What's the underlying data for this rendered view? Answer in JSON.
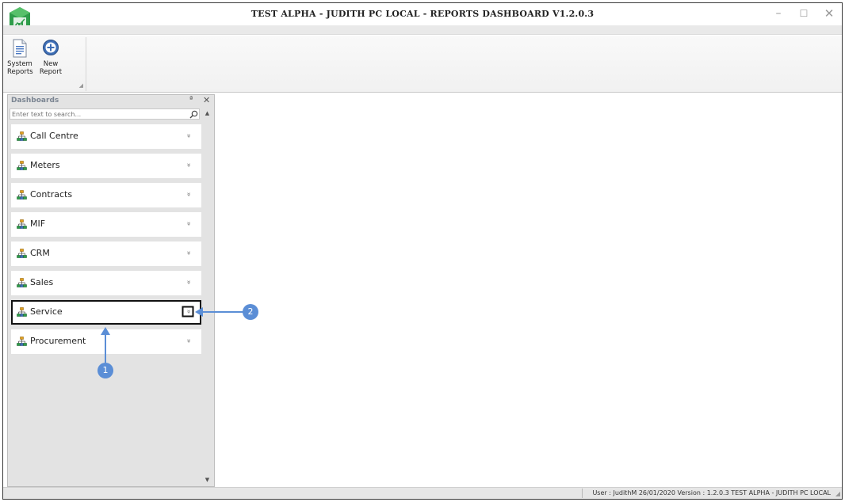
{
  "window": {
    "title": "TEST ALPHA - JUDITH PC LOCAL - REPORTS DASHBOARD V1.2.0.3",
    "minimize_glyph": "–",
    "maximize_glyph": "☐",
    "close_glyph": "✕"
  },
  "ribbon": {
    "system_reports_label": "System Reports",
    "new_report_label": "New Report",
    "system_reports_icon": "document-icon",
    "new_report_icon": "add-circle-icon"
  },
  "panel": {
    "title": "Dashboards",
    "pin_glyph": "ª",
    "close_glyph": "✕",
    "search_placeholder": "Enter text to search...",
    "groups": [
      {
        "label": "Call Centre",
        "icon": "org-chart-icon",
        "chevron": "»"
      },
      {
        "label": "Meters",
        "icon": "org-chart-icon",
        "chevron": "»"
      },
      {
        "label": "Contracts",
        "icon": "org-chart-icon",
        "chevron": "»"
      },
      {
        "label": "MIF",
        "icon": "org-chart-icon",
        "chevron": "»"
      },
      {
        "label": "CRM",
        "icon": "org-chart-icon",
        "chevron": "»"
      },
      {
        "label": "Sales",
        "icon": "org-chart-icon",
        "chevron": "»"
      },
      {
        "label": "Service",
        "icon": "org-chart-icon",
        "chevron": "»",
        "highlighted": true
      },
      {
        "label": "Procurement",
        "icon": "org-chart-icon",
        "chevron": "»"
      }
    ]
  },
  "statusbar": {
    "text": "User : JudithM   26/01/2020   Version : 1.2.0.3   TEST ALPHA - JUDITH PC LOCAL"
  },
  "callouts": [
    {
      "number": "1"
    },
    {
      "number": "2"
    }
  ],
  "colors": {
    "callout": "#5b8ed6",
    "logo_green": "#2e9c4a",
    "panel_bg": "#e3e3e3",
    "highlight_border": "#111111"
  }
}
